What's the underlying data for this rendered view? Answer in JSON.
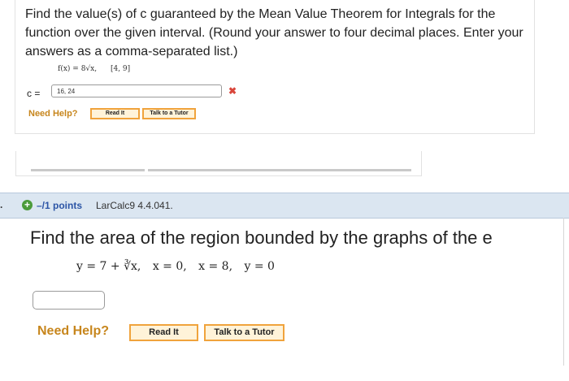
{
  "question1": {
    "prompt": "Find the value(s) of c guaranteed by the Mean Value Theorem for Integrals for the function over the given interval. (Round your answer to four decimal places. Enter your answers as a comma-separated list.)",
    "function": "f(x) = 8√x,",
    "interval": "[4, 9]",
    "answer_label": "c =",
    "answer_value": "16, 24",
    "result_mark": "✖",
    "need_help": "Need Help?",
    "read_it": "Read It",
    "talk_to_tutor": "Talk to a Tutor"
  },
  "question2": {
    "number": ".",
    "points": "–/1 points",
    "source": "LarCalc9 4.4.041.",
    "prompt": "Find the area of the region bounded by the graphs of the e",
    "eq1": "y = 7 + ∛x,",
    "eq2": "x = 0,",
    "eq3": "x = 8,",
    "eq4": "y = 0",
    "answer_value": "",
    "need_help": "Need Help?",
    "read_it": "Read It",
    "talk_to_tutor": "Talk to a Tutor"
  },
  "colors": {
    "help": "#c7861d",
    "button_border": "#f0a33c",
    "header_bg": "#dbe6f1",
    "points": "#2c55a6",
    "error": "#d9463b"
  }
}
